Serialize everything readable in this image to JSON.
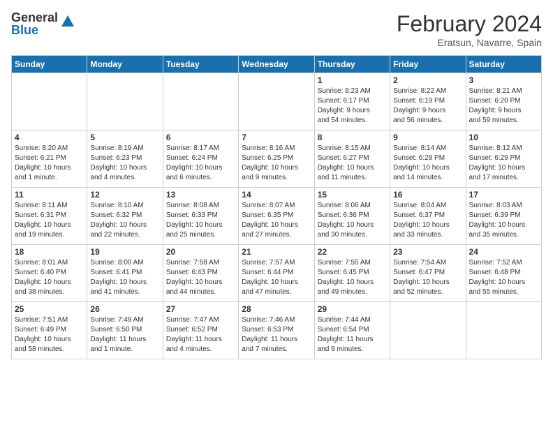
{
  "logo": {
    "general": "General",
    "blue": "Blue"
  },
  "title": {
    "month_year": "February 2024",
    "location": "Eratsun, Navarre, Spain"
  },
  "headers": [
    "Sunday",
    "Monday",
    "Tuesday",
    "Wednesday",
    "Thursday",
    "Friday",
    "Saturday"
  ],
  "weeks": [
    [
      {
        "day": "",
        "info": ""
      },
      {
        "day": "",
        "info": ""
      },
      {
        "day": "",
        "info": ""
      },
      {
        "day": "",
        "info": ""
      },
      {
        "day": "1",
        "info": "Sunrise: 8:23 AM\nSunset: 6:17 PM\nDaylight: 9 hours\nand 54 minutes."
      },
      {
        "day": "2",
        "info": "Sunrise: 8:22 AM\nSunset: 6:19 PM\nDaylight: 9 hours\nand 56 minutes."
      },
      {
        "day": "3",
        "info": "Sunrise: 8:21 AM\nSunset: 6:20 PM\nDaylight: 9 hours\nand 59 minutes."
      }
    ],
    [
      {
        "day": "4",
        "info": "Sunrise: 8:20 AM\nSunset: 6:21 PM\nDaylight: 10 hours\nand 1 minute."
      },
      {
        "day": "5",
        "info": "Sunrise: 8:19 AM\nSunset: 6:23 PM\nDaylight: 10 hours\nand 4 minutes."
      },
      {
        "day": "6",
        "info": "Sunrise: 8:17 AM\nSunset: 6:24 PM\nDaylight: 10 hours\nand 6 minutes."
      },
      {
        "day": "7",
        "info": "Sunrise: 8:16 AM\nSunset: 6:25 PM\nDaylight: 10 hours\nand 9 minutes."
      },
      {
        "day": "8",
        "info": "Sunrise: 8:15 AM\nSunset: 6:27 PM\nDaylight: 10 hours\nand 11 minutes."
      },
      {
        "day": "9",
        "info": "Sunrise: 8:14 AM\nSunset: 6:28 PM\nDaylight: 10 hours\nand 14 minutes."
      },
      {
        "day": "10",
        "info": "Sunrise: 8:12 AM\nSunset: 6:29 PM\nDaylight: 10 hours\nand 17 minutes."
      }
    ],
    [
      {
        "day": "11",
        "info": "Sunrise: 8:11 AM\nSunset: 6:31 PM\nDaylight: 10 hours\nand 19 minutes."
      },
      {
        "day": "12",
        "info": "Sunrise: 8:10 AM\nSunset: 6:32 PM\nDaylight: 10 hours\nand 22 minutes."
      },
      {
        "day": "13",
        "info": "Sunrise: 8:08 AM\nSunset: 6:33 PM\nDaylight: 10 hours\nand 25 minutes."
      },
      {
        "day": "14",
        "info": "Sunrise: 8:07 AM\nSunset: 6:35 PM\nDaylight: 10 hours\nand 27 minutes."
      },
      {
        "day": "15",
        "info": "Sunrise: 8:06 AM\nSunset: 6:36 PM\nDaylight: 10 hours\nand 30 minutes."
      },
      {
        "day": "16",
        "info": "Sunrise: 8:04 AM\nSunset: 6:37 PM\nDaylight: 10 hours\nand 33 minutes."
      },
      {
        "day": "17",
        "info": "Sunrise: 8:03 AM\nSunset: 6:39 PM\nDaylight: 10 hours\nand 35 minutes."
      }
    ],
    [
      {
        "day": "18",
        "info": "Sunrise: 8:01 AM\nSunset: 6:40 PM\nDaylight: 10 hours\nand 38 minutes."
      },
      {
        "day": "19",
        "info": "Sunrise: 8:00 AM\nSunset: 6:41 PM\nDaylight: 10 hours\nand 41 minutes."
      },
      {
        "day": "20",
        "info": "Sunrise: 7:58 AM\nSunset: 6:43 PM\nDaylight: 10 hours\nand 44 minutes."
      },
      {
        "day": "21",
        "info": "Sunrise: 7:57 AM\nSunset: 6:44 PM\nDaylight: 10 hours\nand 47 minutes."
      },
      {
        "day": "22",
        "info": "Sunrise: 7:55 AM\nSunset: 6:45 PM\nDaylight: 10 hours\nand 49 minutes."
      },
      {
        "day": "23",
        "info": "Sunrise: 7:54 AM\nSunset: 6:47 PM\nDaylight: 10 hours\nand 52 minutes."
      },
      {
        "day": "24",
        "info": "Sunrise: 7:52 AM\nSunset: 6:48 PM\nDaylight: 10 hours\nand 55 minutes."
      }
    ],
    [
      {
        "day": "25",
        "info": "Sunrise: 7:51 AM\nSunset: 6:49 PM\nDaylight: 10 hours\nand 58 minutes."
      },
      {
        "day": "26",
        "info": "Sunrise: 7:49 AM\nSunset: 6:50 PM\nDaylight: 11 hours\nand 1 minute."
      },
      {
        "day": "27",
        "info": "Sunrise: 7:47 AM\nSunset: 6:52 PM\nDaylight: 11 hours\nand 4 minutes."
      },
      {
        "day": "28",
        "info": "Sunrise: 7:46 AM\nSunset: 6:53 PM\nDaylight: 11 hours\nand 7 minutes."
      },
      {
        "day": "29",
        "info": "Sunrise: 7:44 AM\nSunset: 6:54 PM\nDaylight: 11 hours\nand 9 minutes."
      },
      {
        "day": "",
        "info": ""
      },
      {
        "day": "",
        "info": ""
      }
    ]
  ]
}
